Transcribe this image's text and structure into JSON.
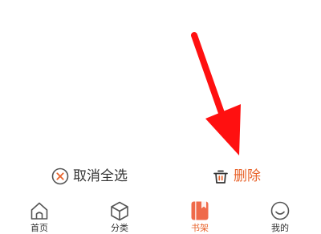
{
  "actions": {
    "cancel_select_all": "取消全选",
    "delete": "删除"
  },
  "tabs": [
    {
      "label": "首页",
      "icon": "home-icon",
      "active": false
    },
    {
      "label": "分类",
      "icon": "category-cube-icon",
      "active": false
    },
    {
      "label": "书架",
      "icon": "bookshelf-icon",
      "active": true
    },
    {
      "label": "我的",
      "icon": "profile-smile-icon",
      "active": false
    }
  ],
  "colors": {
    "accent": "#e8632b",
    "arrow": "#ff1010",
    "text": "#333333",
    "icon": "#555555"
  }
}
